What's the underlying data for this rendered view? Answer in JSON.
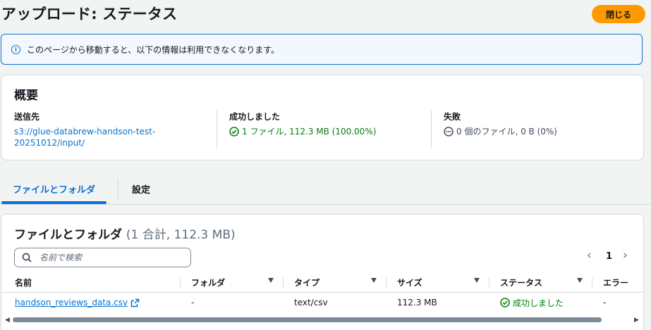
{
  "header": {
    "title": "アップロード: ステータス",
    "close_label": "閉じる"
  },
  "alert": {
    "icon": "info-icon",
    "text": "このページから移動すると、以下の情報は利用できなくなります。"
  },
  "summary": {
    "title": "概要",
    "destination": {
      "label": "送信先",
      "line1": "s3://glue-databrew-handson-test-",
      "line2": "20251012/input/"
    },
    "succeeded": {
      "label": "成功しました",
      "value": "1 ファイル, 112.3 MB (100.00%)"
    },
    "failed": {
      "label": "失敗",
      "value": "0 個のファイル, 0 B (0%)"
    }
  },
  "tabs": [
    {
      "label": "ファイルとフォルダ",
      "active": true
    },
    {
      "label": "設定",
      "active": false
    }
  ],
  "files": {
    "title": "ファイルとフォルダ",
    "count": "(1 合計, 112.3 MB)",
    "search_placeholder": "名前で検索",
    "pager": {
      "prev": "‹",
      "page": "1",
      "next": "›"
    },
    "columns": [
      "名前",
      "フォルダ",
      "タイプ",
      "サイズ",
      "ステータス",
      "エラー"
    ],
    "rows": [
      {
        "name": "handson_reviews_data.csv",
        "folder": "-",
        "type": "text/csv",
        "size": "112.3 MB",
        "status": "成功しました",
        "error": "-"
      }
    ]
  },
  "colors": {
    "accent": "#0972d3",
    "primary_button": "#ff9900",
    "success": "#037f0c"
  }
}
